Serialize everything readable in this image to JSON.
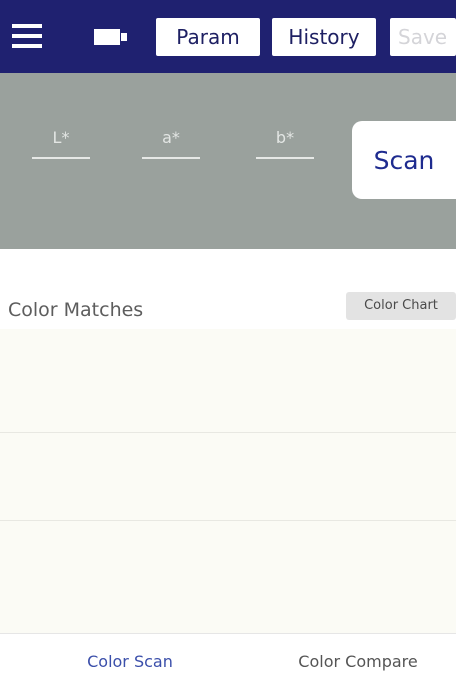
{
  "header": {
    "param_label": "Param",
    "history_label": "History",
    "save_label": "Save",
    "menu_icon": "hamburger-menu-icon",
    "battery_icon": "battery-icon"
  },
  "scan_panel": {
    "fields": [
      {
        "label": "L*"
      },
      {
        "label": "a*"
      },
      {
        "label": "b*"
      }
    ],
    "scan_label": "Scan"
  },
  "matches": {
    "title": "Color Matches",
    "chart_label": "Color Chart"
  },
  "bottom_nav": {
    "tabs": [
      {
        "label": "Color Scan"
      },
      {
        "label": "Color Compare"
      }
    ]
  },
  "colors": {
    "header_bg": "#1f2170",
    "panel_bg": "#9aa19d",
    "accent": "#1e2b8f",
    "list_bg": "#fbfbf5"
  }
}
